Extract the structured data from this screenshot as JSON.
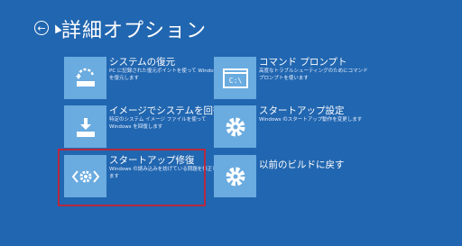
{
  "header": {
    "back_icon": "back-arrow-icon",
    "title": "詳細オプション"
  },
  "options": [
    {
      "title": "システムの復元",
      "desc": "PC に記録された復元ポイントを使って Windows を復元します",
      "icon": "system-restore-icon"
    },
    {
      "title": "コマンド プロンプト",
      "desc": "高度なトラブルシューティングのためにコマンド プロンプトを使います",
      "icon": "command-prompt-icon",
      "icon_text": "C:\\"
    },
    {
      "title": "イメージでシステムを回復",
      "desc": "特定のシステム イメージ ファイルを使って Windows を回復します",
      "icon": "image-recovery-icon"
    },
    {
      "title": "スタートアップ設定",
      "desc": "Windows のスタートアップ動作を変更します",
      "icon": "gear-icon"
    },
    {
      "title": "スタートアップ修復",
      "desc": "Windows の読み込みを妨げている問題を修正します",
      "icon": "startup-repair-icon",
      "icon_text": "‹⚙›"
    },
    {
      "title": "以前のビルドに戻す",
      "desc": "",
      "icon": "gear-icon"
    }
  ],
  "colors": {
    "background": "#2166b0",
    "tile": "#6aabe0",
    "highlight": "#b7293e"
  }
}
